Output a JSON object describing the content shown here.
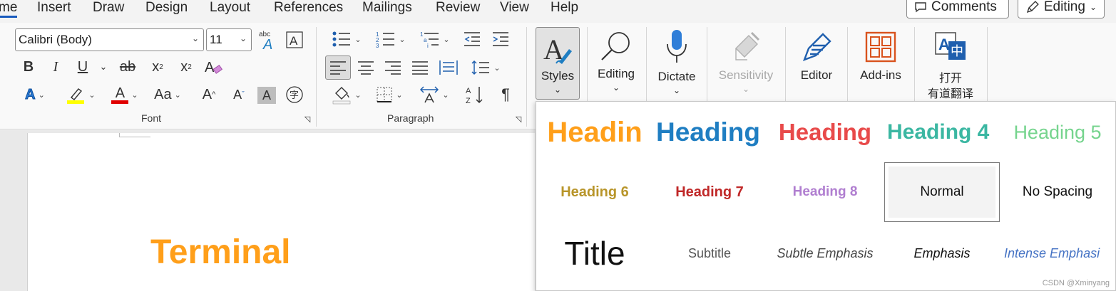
{
  "menu": {
    "tabs": [
      "me",
      "Insert",
      "Draw",
      "Design",
      "Layout",
      "References",
      "Mailings",
      "Review",
      "View",
      "Help"
    ],
    "comments_label": "Comments",
    "editing_label": "Editing"
  },
  "font_group": {
    "font_name": "Calibri (Body)",
    "font_size": "11",
    "label": "Font",
    "bold": "B",
    "italic": "I",
    "underline": "U",
    "strikethrough": "ab",
    "subscript": "x",
    "superscript": "x",
    "change_case": "Aa",
    "grow": "A",
    "shrink": "A",
    "font_color": "A",
    "char_shading": "A",
    "text_effects": "A"
  },
  "paragraph_group": {
    "label": "Paragraph",
    "pilcrow": "¶"
  },
  "big_buttons": {
    "styles": "Styles",
    "editing": "Editing",
    "dictate": "Dictate",
    "sensitivity": "Sensitivity",
    "editor": "Editor",
    "addins": "Add-ins",
    "translate_line1": "打开",
    "translate_line2": "有道翻译"
  },
  "document": {
    "text": "Terminal"
  },
  "styles_gallery": {
    "row1": [
      "Headin",
      "Heading",
      "Heading",
      "Heading 4",
      "Heading 5"
    ],
    "row2": [
      "Heading 6",
      "Heading 7",
      "Heading 8",
      "Normal",
      "No Spacing"
    ],
    "row3": [
      "Title",
      "Subtitle",
      "Subtle Emphasis",
      "Emphasis",
      "Intense Emphasi"
    ]
  },
  "colors": {
    "accent_blue": "#185abd",
    "heading1": "#ff9f1a",
    "heading2": "#1f7ec2",
    "heading3": "#e84a4a",
    "heading4": "#3bb7a2",
    "heading5": "#76d48e",
    "heading6": "#b8952a",
    "heading7": "#c02828",
    "heading8": "#b07ed0",
    "intense_emphasis": "#4472c4",
    "terminal": "#ff9f1a"
  },
  "watermark": "CSDN @Xminyang"
}
